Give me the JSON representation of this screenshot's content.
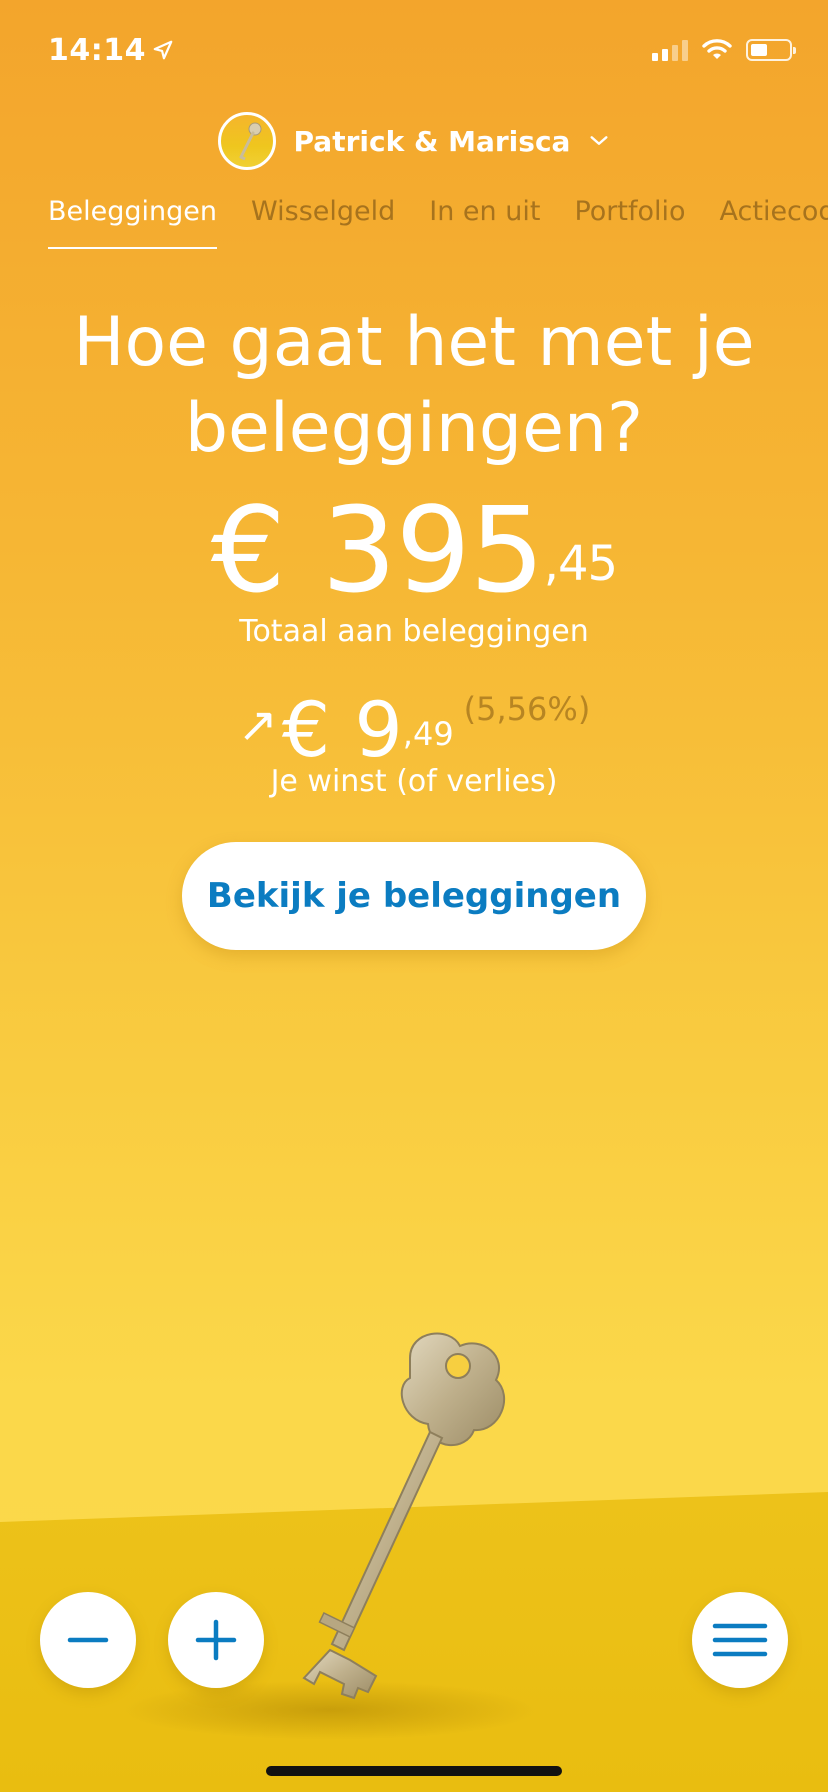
{
  "status_bar": {
    "time": "14:14",
    "battery_level": 0.4,
    "signal_bars": 2
  },
  "account": {
    "name": "Patrick & Marisca"
  },
  "tabs": [
    {
      "label": "Beleggingen",
      "active": true
    },
    {
      "label": "Wisselgeld"
    },
    {
      "label": "In en uit"
    },
    {
      "label": "Portfolio"
    },
    {
      "label": "Actiecode"
    }
  ],
  "hero": {
    "headline_line1": "Hoe gaat het met je",
    "headline_line2": "beleggingen?",
    "total_main": "€ 395",
    "total_cents": ",45",
    "total_label": "Totaal aan beleggingen",
    "gain_arrow": "↗",
    "gain_main": "€ 9",
    "gain_cents": ",49",
    "gain_pct": "(5,56%)",
    "gain_label": "Je winst (of verlies)"
  },
  "cta": {
    "label": "Bekijk je beleggingen"
  },
  "colors": {
    "accent_blue": "#0B7CC1",
    "bg_top": "#F3A52C",
    "bg_bottom": "#FBDA4B"
  }
}
